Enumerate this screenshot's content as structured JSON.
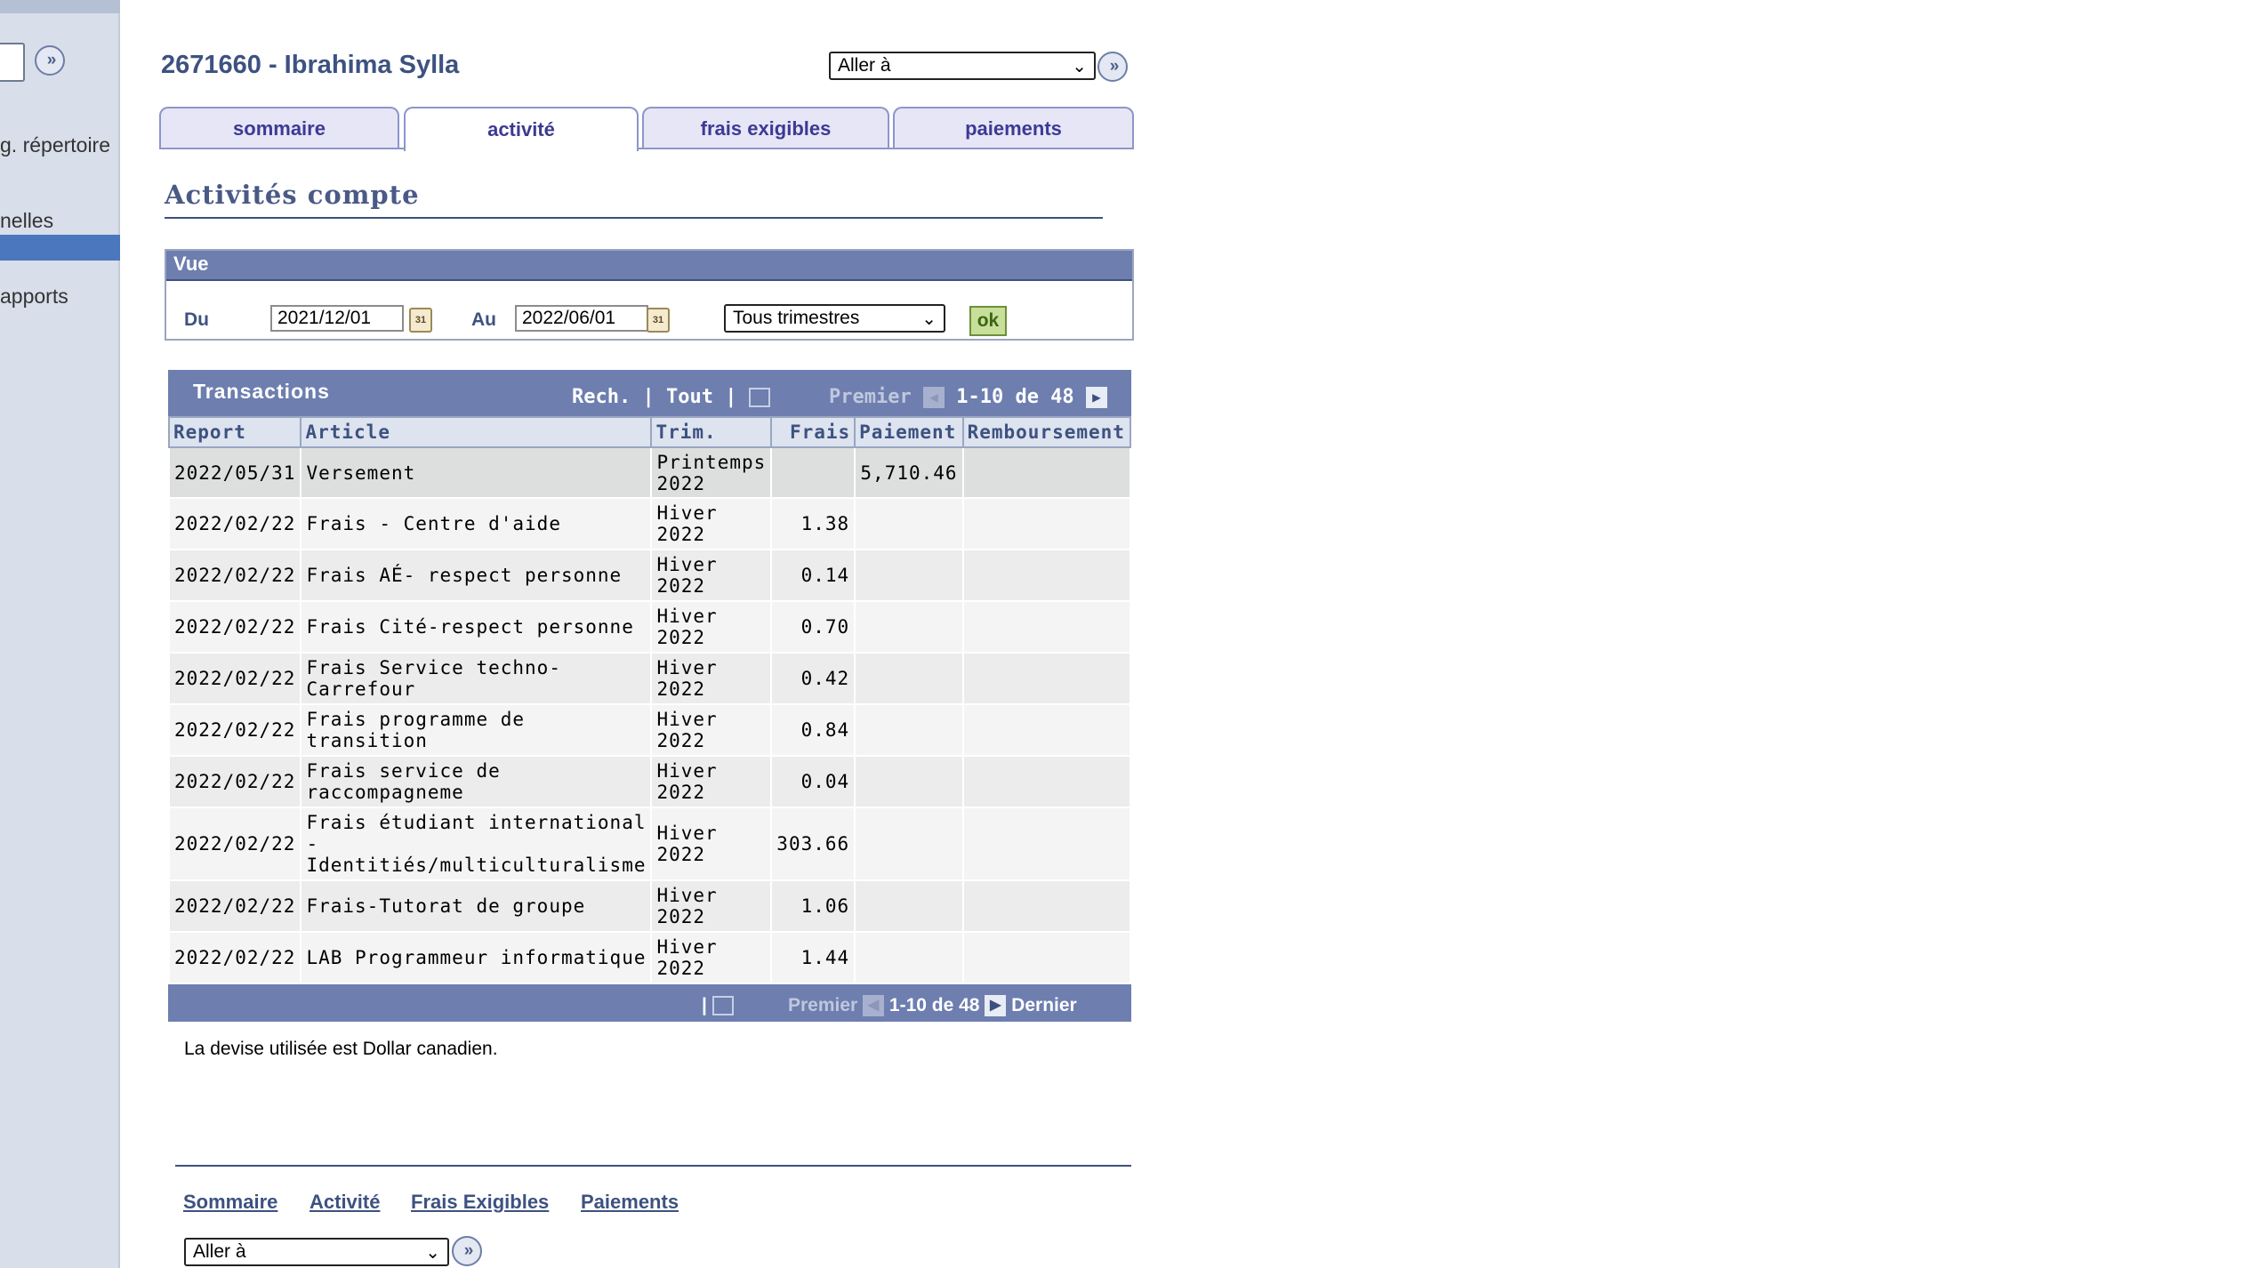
{
  "sidebar": {
    "items": [
      {
        "label": "g. répertoire"
      },
      {
        "label": "nelles"
      },
      {
        "label": "apports"
      }
    ]
  },
  "header": {
    "student": "2671660 - Ibrahima Sylla",
    "goto_label": "Aller à"
  },
  "tabs": [
    {
      "label": "sommaire",
      "active": false
    },
    {
      "label": "activité",
      "active": true
    },
    {
      "label": "frais exigibles",
      "active": false
    },
    {
      "label": "paiements",
      "active": false
    }
  ],
  "section": {
    "title": "Activités compte"
  },
  "view": {
    "header": "Vue",
    "from_label": "Du",
    "from_value": "2021/12/01",
    "to_label": "Au",
    "to_value": "2022/06/01",
    "term_select": "Tous trimestres",
    "ok_label": "ok",
    "calendar_icon_text": "31"
  },
  "grid": {
    "title": "Transactions",
    "search_label": "Rech.",
    "all_label": "Tout",
    "first_label": "Premier",
    "range_label": "1-10 de 48",
    "last_label": "Dernier",
    "columns": [
      "Report",
      "Article",
      "Trim.",
      "Frais",
      "Paiement",
      "Remboursement"
    ],
    "rows": [
      {
        "date": "2022/05/31",
        "article": "Versement",
        "term": "Printemps 2022",
        "frais": "",
        "paiement": "5,710.46",
        "remb": ""
      },
      {
        "date": "2022/02/22",
        "article": "Frais - Centre d'aide",
        "term": "Hiver 2022",
        "frais": "1.38",
        "paiement": "",
        "remb": ""
      },
      {
        "date": "2022/02/22",
        "article": "Frais AÉ- respect personne",
        "term": "Hiver 2022",
        "frais": "0.14",
        "paiement": "",
        "remb": ""
      },
      {
        "date": "2022/02/22",
        "article": "Frais Cité-respect personne",
        "term": "Hiver 2022",
        "frais": "0.70",
        "paiement": "",
        "remb": ""
      },
      {
        "date": "2022/02/22",
        "article": "Frais Service techno-Carrefour",
        "term": "Hiver 2022",
        "frais": "0.42",
        "paiement": "",
        "remb": ""
      },
      {
        "date": "2022/02/22",
        "article": "Frais programme de transition",
        "term": "Hiver 2022",
        "frais": "0.84",
        "paiement": "",
        "remb": ""
      },
      {
        "date": "2022/02/22",
        "article": "Frais service de raccompagneme",
        "term": "Hiver 2022",
        "frais": "0.04",
        "paiement": "",
        "remb": ""
      },
      {
        "date": "2022/02/22",
        "article": "Frais étudiant international - Identitiés/multiculturalisme",
        "term": "Hiver 2022",
        "frais": "303.66",
        "paiement": "",
        "remb": ""
      },
      {
        "date": "2022/02/22",
        "article": "Frais-Tutorat de groupe",
        "term": "Hiver 2022",
        "frais": "1.06",
        "paiement": "",
        "remb": ""
      },
      {
        "date": "2022/02/22",
        "article": "LAB Programmeur informatique",
        "term": "Hiver 2022",
        "frais": "1.44",
        "paiement": "",
        "remb": ""
      }
    ]
  },
  "currency_note": "La devise utilisée est Dollar canadien.",
  "footer": {
    "links": [
      "Sommaire",
      "Activité",
      "Frais Exigibles",
      "Paiements"
    ],
    "goto_label": "Aller à"
  },
  "colors": {
    "sidebar_bg": "#d8dfea",
    "header_bar": "#6d7eaf",
    "title_text": "#3d5280",
    "tab_text": "#3d3a93",
    "active_nav": "#4a77bd"
  }
}
